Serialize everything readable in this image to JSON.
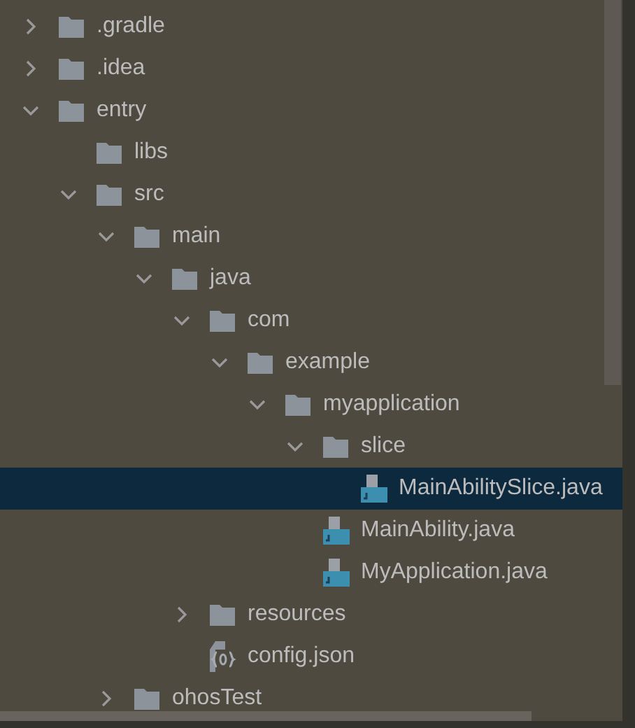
{
  "tree": [
    {
      "label": ".gradle",
      "kind": "folder",
      "expanded": false
    },
    {
      "label": ".idea",
      "kind": "folder",
      "expanded": false
    },
    {
      "label": "entry",
      "kind": "folder",
      "expanded": true,
      "children": [
        {
          "label": "libs",
          "kind": "folder"
        },
        {
          "label": "src",
          "kind": "folder",
          "expanded": true,
          "children": [
            {
              "label": "main",
              "kind": "folder",
              "expanded": true,
              "children": [
                {
                  "label": "java",
                  "kind": "folder",
                  "expanded": true,
                  "children": [
                    {
                      "label": "com",
                      "kind": "folder",
                      "expanded": true,
                      "children": [
                        {
                          "label": "example",
                          "kind": "folder",
                          "expanded": true,
                          "children": [
                            {
                              "label": "myapplication",
                              "kind": "folder",
                              "expanded": true,
                              "children": [
                                {
                                  "label": "slice",
                                  "kind": "folder",
                                  "expanded": true,
                                  "children": [
                                    {
                                      "label": "MainAbilitySlice.java",
                                      "kind": "java",
                                      "selected": true
                                    }
                                  ]
                                },
                                {
                                  "label": "MainAbility.java",
                                  "kind": "java",
                                  "selected": false
                                },
                                {
                                  "label": "MyApplication.java",
                                  "kind": "java",
                                  "selected": false
                                }
                              ]
                            }
                          ]
                        }
                      ]
                    },
                    {
                      "label": "resources",
                      "kind": "folder",
                      "expanded": false
                    },
                    {
                      "label": "config.json",
                      "kind": "json"
                    }
                  ]
                }
              ]
            },
            {
              "label": "ohosTest",
              "kind": "folder",
              "expanded": false
            }
          ]
        }
      ]
    }
  ]
}
